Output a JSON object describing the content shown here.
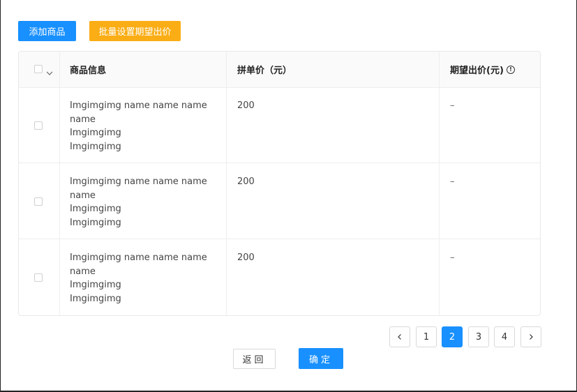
{
  "toolbar": {
    "add_label": "添加商品",
    "batch_label": "批量设置期望出价"
  },
  "table": {
    "headers": {
      "info": "商品信息",
      "price": "拼单价（元）",
      "expected": "期望出价(元)"
    },
    "rows": [
      {
        "lines": [
          "Imgimgimg  name name name",
          "name",
          "Imgimgimg",
          "Imgimgimg"
        ],
        "price": "200",
        "expected": "–"
      },
      {
        "lines": [
          "Imgimgimg  name name name",
          "name",
          "Imgimgimg",
          "Imgimgimg"
        ],
        "price": "200",
        "expected": "–"
      },
      {
        "lines": [
          "Imgimgimg  name name name",
          "name",
          "Imgimgimg",
          "Imgimgimg"
        ],
        "price": "200",
        "expected": "–"
      }
    ]
  },
  "pagination": {
    "pages": [
      "1",
      "2",
      "3",
      "4"
    ],
    "current": "2"
  },
  "footer": {
    "back_label": "返回",
    "confirm_label": "确定"
  },
  "colors": {
    "primary": "#1890ff",
    "warning": "#faad14"
  },
  "icons": {
    "prev": "chevron-left-icon",
    "next": "chevron-right-icon",
    "info": "info-circle-icon",
    "dropdown": "chevron-down-icon"
  }
}
